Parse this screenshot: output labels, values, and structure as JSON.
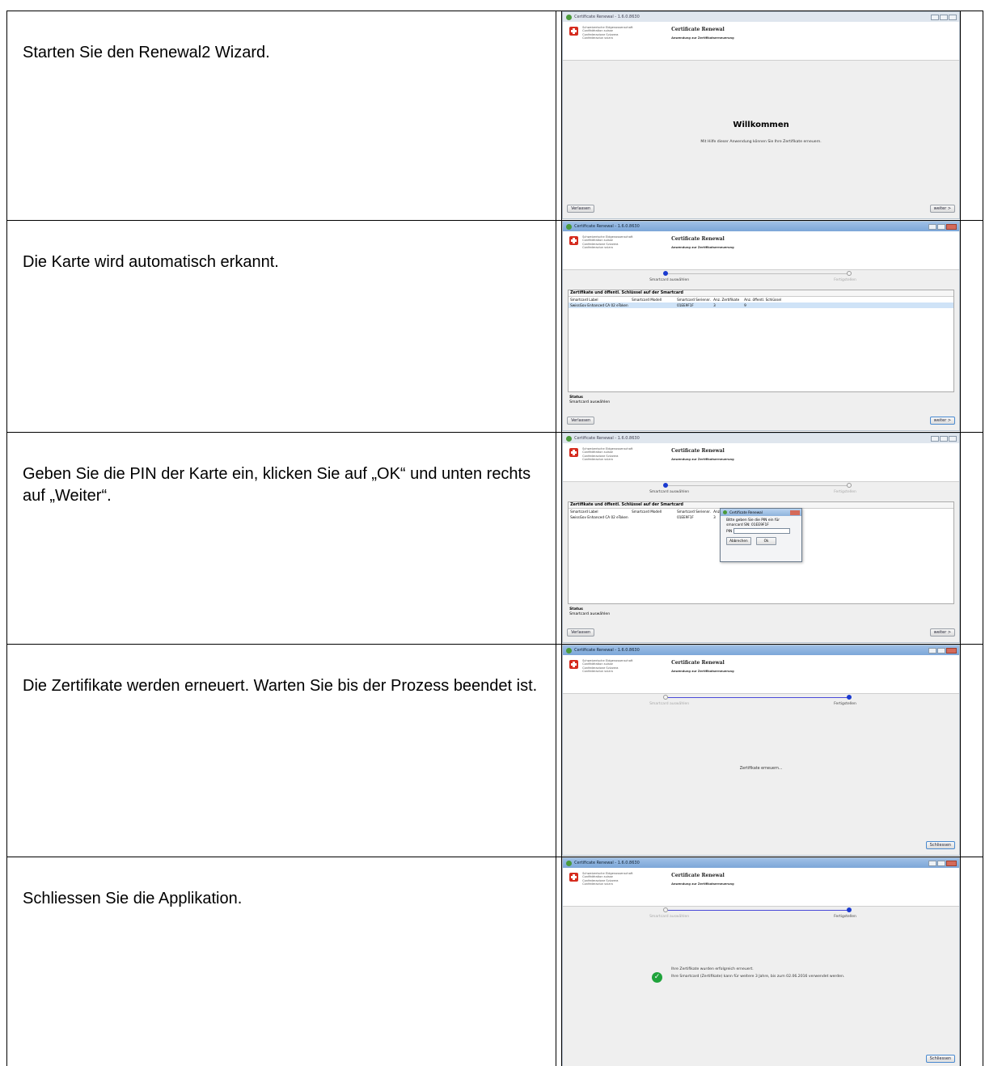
{
  "instructions": [
    "Starten Sie den Renewal2 Wizard.",
    "Die Karte wird automatisch erkannt.",
    "Geben Sie die PIN der Karte ein, klicken Sie auf „OK“ und unten rechts auf „Weiter“.",
    "Die Zertifikate werden erneuert. Warten Sie bis der Prozess beendet ist.",
    "Schliessen Sie die Applikation."
  ],
  "app": {
    "window_title": "Certificate Renewal - 1.6.0.8630",
    "confederation": [
      "Schweizerische Eidgenossenschaft",
      "Confédération suisse",
      "Confederazione Svizzera",
      "Confederaziun svizra"
    ],
    "title": "Certificate Renewal",
    "subtitle": "Anwendung zur Zertifikatserneuerung",
    "btn_leave": "Verlassen",
    "btn_next": "weiter >",
    "btn_close": "Schliessen",
    "step1": "Smartcard auswählen",
    "step2": "Fertigstellen"
  },
  "welcome": {
    "heading": "Willkommen",
    "text": "Mit Hilfe dieser Anwendung können Sie Ihre Zertifikate erneuern."
  },
  "card_table": {
    "heading": "Zertifikate und öffentl. Schlüssel auf der Smartcard",
    "columns": [
      "Smartcard Label",
      "Smartcard Modell",
      "Smartcard Seriennr.",
      "Anz. Zertifikate",
      "Anz. öffentl. Schlüssel"
    ],
    "row": [
      "SwissGov Enhanced CA 02 eToken",
      "",
      "01EE9F1F",
      "3",
      "9"
    ],
    "status_label": "Status",
    "status_value": "Smartcard auswählen"
  },
  "pin_dialog": {
    "title": "Certificate Renewal",
    "line1": "Bitte geben Sie die PIN ein für",
    "line2": "smarcard SN: 01EE9F1F",
    "pin_label": "PIN",
    "cancel": "Abbrechen",
    "ok": "Ok"
  },
  "renewing": {
    "text": "Zertifikate erneuern..."
  },
  "done": {
    "line1": "Ihre Zertifikate wurden erfolgreich erneuert.",
    "line2": "Ihre Smartcard (Zertifikate) kann für weitere 3 Jahre, bis zum 02.06.2016 verwendet werden."
  }
}
